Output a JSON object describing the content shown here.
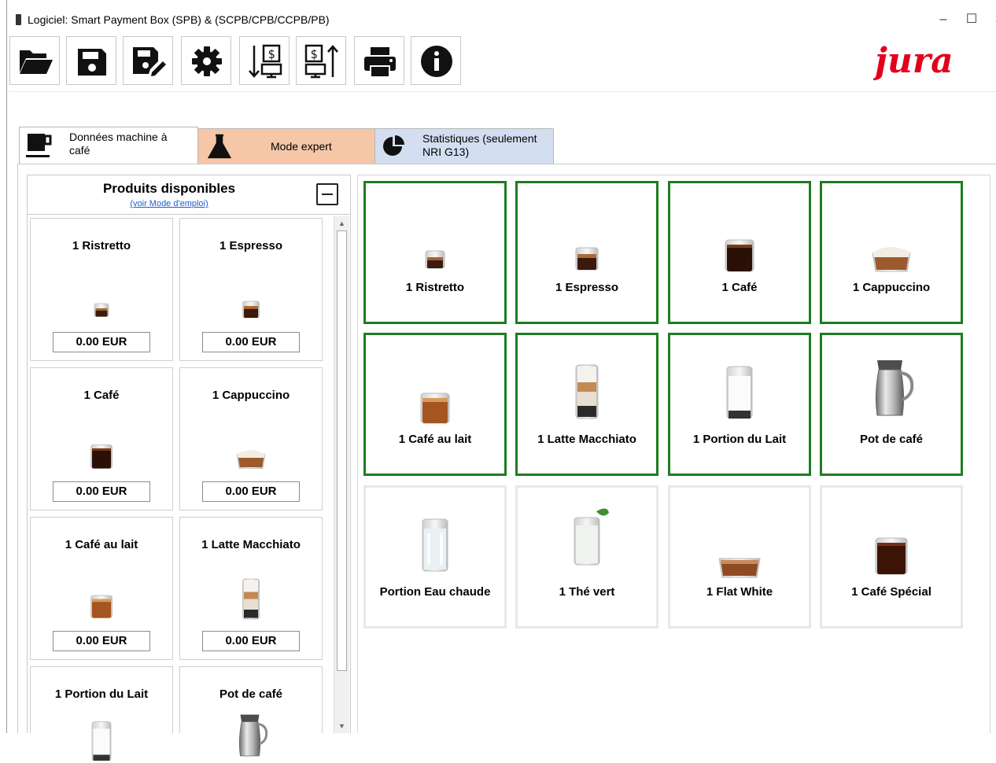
{
  "window": {
    "title": "Logiciel: Smart Payment Box (SPB) & (SCPB/CPB/CCPB/PB)",
    "min_label": "–",
    "max_label": "☐",
    "close_label": "×"
  },
  "toolbar": {
    "buttons": [
      {
        "name": "open-folder-button",
        "icon": "folder-open-icon"
      },
      {
        "name": "save-button",
        "icon": "floppy-disk-icon"
      },
      {
        "name": "save-as-button",
        "icon": "floppy-edit-icon"
      },
      {
        "name": "settings-button",
        "icon": "gear-icon"
      },
      {
        "name": "import-prices-button",
        "icon": "download-prices-icon"
      },
      {
        "name": "export-prices-button",
        "icon": "upload-prices-icon"
      },
      {
        "name": "print-button",
        "icon": "printer-icon"
      },
      {
        "name": "info-button",
        "icon": "info-icon"
      }
    ],
    "price_glyph": "$"
  },
  "brand": {
    "logo_text": "jura",
    "color": "#e3001b"
  },
  "tabs": [
    {
      "label": "Données machine à café",
      "icon": "coffee-cup-icon",
      "bg": "#ffffff",
      "active": true
    },
    {
      "label": "Mode expert",
      "icon": "flask-icon",
      "bg": "#f5c7a7"
    },
    {
      "label": "Statistiques (seulement NRI G13)",
      "icon": "pie-chart-icon",
      "bg": "#d3dff1"
    }
  ],
  "left_panel": {
    "title": "Produits disponibles",
    "link": "(voir Mode d'emploi)",
    "products": [
      {
        "name": "1 Ristretto",
        "price": "0.00 EUR",
        "img": "ristretto"
      },
      {
        "name": "1 Espresso",
        "price": "0.00 EUR",
        "img": "espresso"
      },
      {
        "name": "1 Café",
        "price": "0.00 EUR",
        "img": "cafe"
      },
      {
        "name": "1 Cappuccino",
        "price": "0.00 EUR",
        "img": "cappuccino"
      },
      {
        "name": "1 Café au lait",
        "price": "0.00 EUR",
        "img": "cafe-au-lait"
      },
      {
        "name": "1 Latte Macchiato",
        "price": "0.00 EUR",
        "img": "latte"
      },
      {
        "name": "1 Portion du Lait",
        "price": "",
        "img": "milk"
      },
      {
        "name": "Pot de café",
        "price": "",
        "img": "pot"
      }
    ]
  },
  "grid": {
    "selected_color": "#1e7d21",
    "items": [
      {
        "name": "1 Ristretto",
        "selected": true,
        "img": "ristretto"
      },
      {
        "name": "1 Espresso",
        "selected": true,
        "img": "espresso"
      },
      {
        "name": "1 Café",
        "selected": true,
        "img": "cafe"
      },
      {
        "name": "1 Cappuccino",
        "selected": true,
        "img": "cappuccino"
      },
      {
        "name": "1 Café au lait",
        "selected": true,
        "img": "cafe-au-lait"
      },
      {
        "name": "1 Latte Macchiato",
        "selected": true,
        "img": "latte"
      },
      {
        "name": "1 Portion du Lait",
        "selected": true,
        "img": "milk"
      },
      {
        "name": "Pot de café",
        "selected": true,
        "img": "pot"
      },
      {
        "name": "Portion Eau chaude",
        "selected": false,
        "img": "water"
      },
      {
        "name": "1 Thé vert",
        "selected": false,
        "img": "tea"
      },
      {
        "name": "1 Flat White",
        "selected": false,
        "img": "flatwhite"
      },
      {
        "name": "1 Café Spécial",
        "selected": false,
        "img": "special"
      }
    ]
  }
}
